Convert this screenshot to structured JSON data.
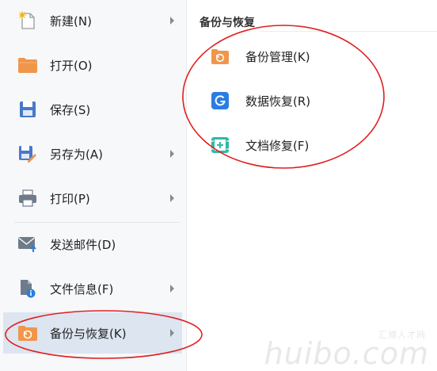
{
  "menu": {
    "items": [
      {
        "label": "新建(N)",
        "icon": "new-file-icon",
        "has_submenu": true
      },
      {
        "label": "打开(O)",
        "icon": "folder-open-icon",
        "has_submenu": false
      },
      {
        "label": "保存(S)",
        "icon": "save-icon",
        "has_submenu": false
      },
      {
        "label": "另存为(A)",
        "icon": "save-as-icon",
        "has_submenu": true
      },
      {
        "label": "打印(P)",
        "icon": "printer-icon",
        "has_submenu": true
      },
      {
        "label": "发送邮件(D)",
        "icon": "email-icon",
        "has_submenu": false
      },
      {
        "label": "文件信息(F)",
        "icon": "file-info-icon",
        "has_submenu": true
      },
      {
        "label": "备份与恢复(K)",
        "icon": "backup-folder-icon",
        "has_submenu": true,
        "active": true
      }
    ]
  },
  "panel": {
    "title": "备份与恢复",
    "items": [
      {
        "label": "备份管理(K)",
        "icon": "backup-manage-icon"
      },
      {
        "label": "数据恢复(R)",
        "icon": "data-recovery-icon"
      },
      {
        "label": "文档修复(F)",
        "icon": "doc-repair-icon"
      }
    ]
  },
  "watermark": {
    "cn": "汇博人才网",
    "en": "huibo.com"
  },
  "colors": {
    "menu_bg": "#f7f8fa",
    "active_bg": "#dce5f0",
    "annotation_red": "#e02020",
    "orange": "#f0964a",
    "blue": "#2a7de1",
    "teal": "#2fb8a8"
  }
}
